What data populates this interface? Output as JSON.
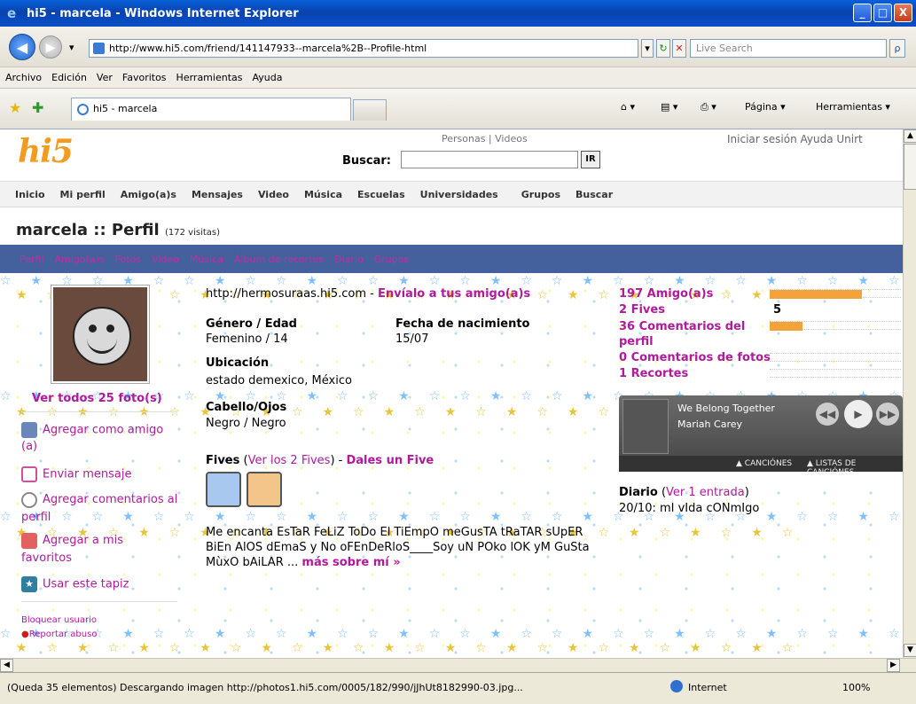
{
  "window": {
    "title": "hi5 - marcela - Windows Internet Explorer",
    "btn_min": "_",
    "btn_max": "□",
    "btn_close": "X"
  },
  "address": {
    "back": "◀",
    "forward": "▶",
    "dropdown": "▾",
    "url": "http://www.hi5.com/friend/141147933--marcela%2B--Profile-html",
    "refresh": "↻",
    "stop": "✕",
    "search_placeholder": "Live Search",
    "search_go": "ρ"
  },
  "menu": [
    "Archivo",
    "Edición",
    "Ver",
    "Favoritos",
    "Herramientas",
    "Ayuda"
  ],
  "tabs": {
    "active_label": "hi5 - marcela",
    "tools": {
      "page": "Página ▾",
      "tools": "Herramientas ▾",
      "home": "⌂ ▾",
      "feeds": "▤ ▾",
      "print": "⎙ ▾"
    }
  },
  "site": {
    "logo": "hi5",
    "search_tabs": "Personas | Videos",
    "search_label": "Buscar:",
    "search_btn": "IR",
    "toplinks": "Iniciar sesión   Ayuda   Unirt",
    "nav": [
      "Inicio",
      "Mi perfil",
      "Amigo(a)s",
      "Mensajes",
      "Video",
      "Música",
      "Escuelas",
      "Universidades",
      "Grupos",
      "Buscar"
    ],
    "title": "marcela :: Perfil",
    "visits": "(172 visitas)",
    "subnav": [
      "Perfil",
      "Amigo(a)s",
      "Fotos",
      "Video",
      "Música",
      "Álbum de recortes",
      "Diario",
      "Grupos"
    ]
  },
  "left": {
    "photos_link": "Ver todos 25 foto(s)",
    "add_friend": "Agregar como amigo (a)",
    "send_msg": "Enviar mensaje",
    "add_comments": "Agregar comentarios al perfil",
    "add_fav": "Agregar a mis favoritos",
    "use_wallpaper": "Usar este tapiz",
    "block": "Bloquear usuario",
    "report": "Reportar abuso"
  },
  "middle": {
    "profile_url": "http://hermosuraas.hi5.com",
    "send_to_friends": "Envíalo a tus amigo(a)s",
    "gender_age_label": "Género / Edad",
    "gender_age": "Femenino / 14",
    "birth_label": "Fecha de nacimiento",
    "birth": "15/07",
    "location_label": "Ubicación",
    "location": "estado demexico, México",
    "hair_label": "Cabello/Ojos",
    "hair": "Negro / Negro",
    "fives_label": "Fives",
    "fives_link": "Ver los 2 Fives",
    "give_five": "Dales un Five",
    "about": "Me encanta EsTaR FeLiZ ToDo El TiEmpO meGusTA tRaTAR sUpER BiEn AlOS dEmaS y No oFEnDeRloS____Soy uN POko lOK yM GuSta MùxO bAiLAR ...",
    "more": "más sobre mí »"
  },
  "right": {
    "friends": "197 Amigo(a)s",
    "fives": "2 Fives",
    "fives_count": "5",
    "comments": "36 Comentarios del perfil",
    "photo_comments": "0 Comentarios de fotos",
    "clips": "1 Recortes",
    "friends_bar": 0.7,
    "fives_bar": 0.05,
    "comments_bar": 0.25,
    "song": "We Belong Together",
    "artist": "Mariah Carey",
    "songs_link": "▲ CANCIÓNES",
    "lists_link": "▲ LISTAS DE CANCIÓNES",
    "diary_label": "Diario",
    "diary_link": "Ver 1 entrada",
    "diary_entry": "20/10: mI vIda cONmIgo"
  },
  "status": {
    "text": "(Queda 35 elementos) Descargando imagen http://photos1.hi5.com/0005/182/990/jJhUt8182990-03.jpg...",
    "zone": "Internet",
    "zoom": "100%"
  },
  "colors": {
    "link": "#b01a9c",
    "subnav_bg": "#3b5998",
    "accent": "#f39b1e"
  }
}
